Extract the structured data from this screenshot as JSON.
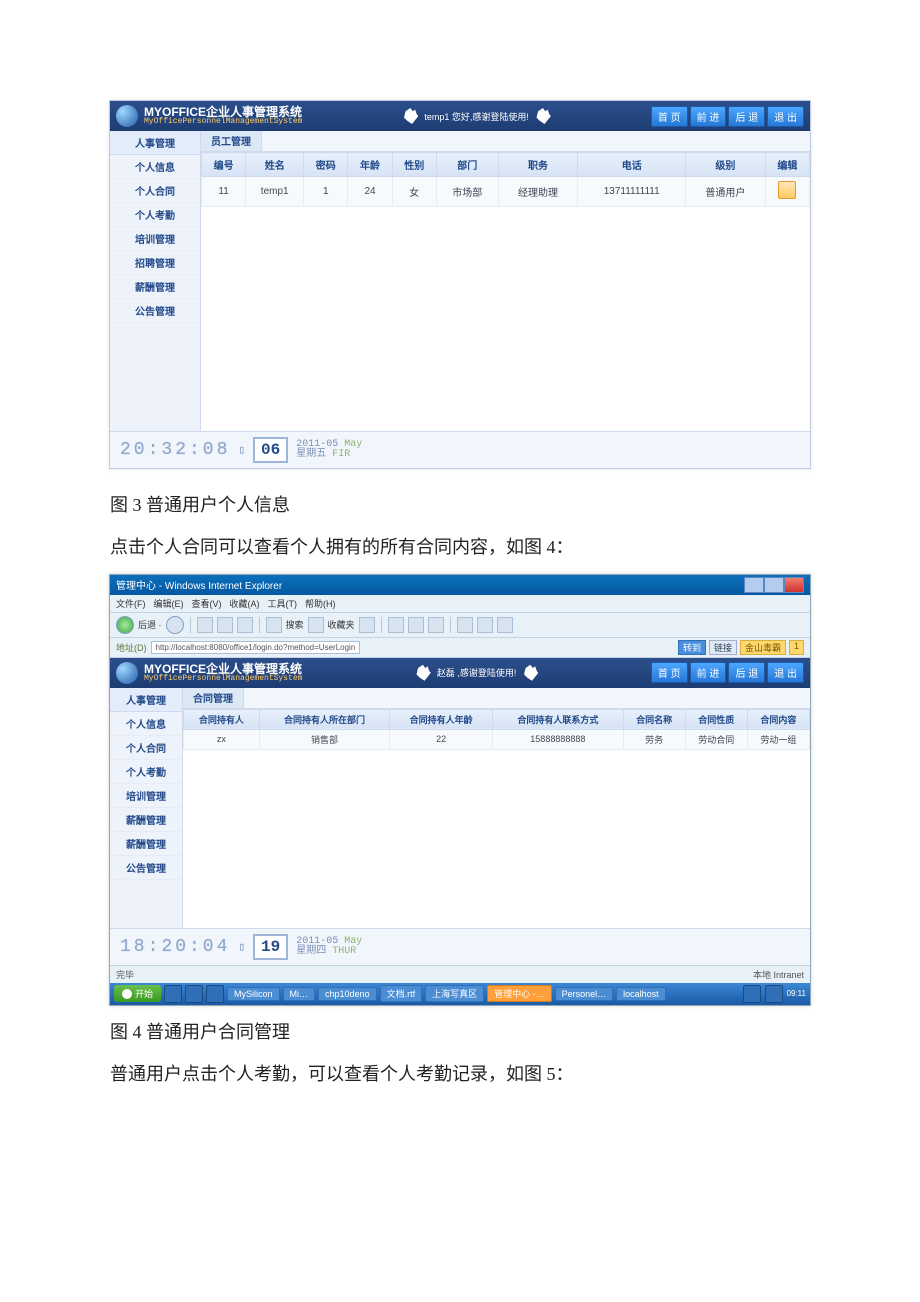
{
  "fig3": {
    "header": {
      "title": "MYOFFICE企业人事管理系统",
      "subtitle": "MyOfficePersonnelManagementSystem",
      "greeting": "temp1 您好,感谢登陆使用!",
      "buttons": [
        "首 页",
        "前 进",
        "后 退",
        "退 出"
      ]
    },
    "sidebar": {
      "head": "人事管理",
      "items": [
        "个人信息",
        "个人合同",
        "个人考勤",
        "培训管理",
        "招聘管理",
        "薪酬管理",
        "公告管理"
      ]
    },
    "tab": "员工管理",
    "columns": [
      "编号",
      "姓名",
      "密码",
      "年龄",
      "性别",
      "部门",
      "职务",
      "电话",
      "级别",
      "编辑"
    ],
    "row": {
      "id": "11",
      "name": "temp1",
      "pwd": "1",
      "age": "24",
      "sex": "女",
      "dept": "市场部",
      "job": "经理助理",
      "tel": "13711111111",
      "level": "普通用户"
    },
    "datetime": {
      "time": "20:32:08",
      "day": "06",
      "ym": "2011-05",
      "ym_en": "May",
      "week": "星期五",
      "week_en": "FIR"
    },
    "caption": "图 3 普通用户个人信息",
    "para": "点击个人合同可以查看个人拥有的所有合同内容，如图 4："
  },
  "fig4": {
    "ie": {
      "title": "管理中心 - Windows Internet Explorer",
      "menus": [
        "文件(F)",
        "编辑(E)",
        "查看(V)",
        "收藏(A)",
        "工具(T)",
        "帮助(H)"
      ],
      "addr_label": "地址(D)",
      "url": "http://localhost:8080/office1/login.do?method=UserLogin",
      "tags": [
        "转到",
        "链接",
        "金山毒霸",
        "1"
      ]
    },
    "header": {
      "title": "MYOFFICE企业人事管理系统",
      "subtitle": "MyOfficePersonnelManagementSystem",
      "greeting": "赵磊 ,感谢登陆使用!",
      "buttons": [
        "首 页",
        "前 进",
        "后 退",
        "退 出"
      ]
    },
    "sidebar": {
      "head": "人事管理",
      "items": [
        "个人信息",
        "个人合同",
        "个人考勤",
        "培训管理",
        "薪酬管理",
        "薪酬管理",
        "公告管理"
      ]
    },
    "tab": "合同管理",
    "columns": [
      "合同持有人",
      "合同持有人所在部门",
      "合同持有人年龄",
      "合同持有人联系方式",
      "合同名称",
      "合同性质",
      "合同内容"
    ],
    "row": {
      "c1": "zx",
      "c2": "销售部",
      "c3": "22",
      "c4": "15888888888",
      "c5": "劳务",
      "c6": "劳动合同",
      "c7": "劳动一组"
    },
    "datetime": {
      "time": "18:20:04",
      "day": "19",
      "ym": "2011-05",
      "ym_en": "May",
      "week": "星期四",
      "week_en": "THUR"
    },
    "status_left": "完毕",
    "status_right": "本地 Intranet",
    "tasks": {
      "start": "开始",
      "items": [
        "MySilicon",
        "Mi…",
        "chp10deno",
        "文档.rtf",
        "上海写真区",
        "管理中心 -…",
        "Personel…",
        "localhost"
      ],
      "tray": "09:11"
    },
    "caption": "图 4 普通用户合同管理",
    "para": "普通用户点击个人考勤，可以查看个人考勤记录，如图 5："
  }
}
